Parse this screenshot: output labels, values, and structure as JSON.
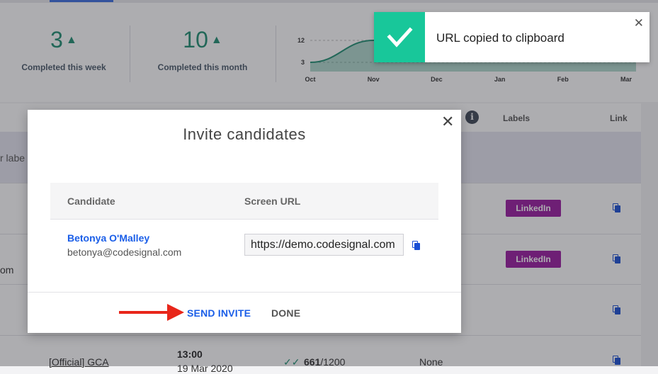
{
  "stats": {
    "week_value": "3",
    "week_label": "Completed this week",
    "month_value": "10",
    "month_label": "Completed this month"
  },
  "chart_data": {
    "type": "area",
    "x": [
      "Oct",
      "Nov",
      "Dec",
      "Jan",
      "Feb",
      "Mar"
    ],
    "y_ticks": [
      3,
      12
    ],
    "series": [
      {
        "values": [
          3,
          12,
          12,
          12,
          12,
          12
        ]
      }
    ],
    "color": "#1f8f72"
  },
  "table": {
    "headers": {
      "labels": "Labels",
      "link": "Link"
    },
    "filter_text": "r labe",
    "rows": [
      {
        "label_badge": "LinkedIn"
      },
      {
        "label_badge": "LinkedIn",
        "left_fragment": "om"
      },
      {},
      {
        "test": "[Official] GCA",
        "time": "13:00",
        "date": "19 Mar 2020",
        "score": "661",
        "score_total": "/1200",
        "status": "None"
      }
    ]
  },
  "toast": {
    "message": "URL copied to clipboard"
  },
  "modal": {
    "title": "Invite candidates",
    "col_candidate": "Candidate",
    "col_screen_url": "Screen URL",
    "candidate_name": "Betonya O'Malley",
    "candidate_email": "betonya@codesignal.com",
    "screen_url": "https://demo.codesignal.com",
    "send_label": "SEND INVITE",
    "done_label": "DONE"
  },
  "colors": {
    "accent_blue": "#1a5ee8",
    "success_green": "#18c79a",
    "badge_purple": "#9a1aa0",
    "arrow_red": "#e8261a"
  }
}
